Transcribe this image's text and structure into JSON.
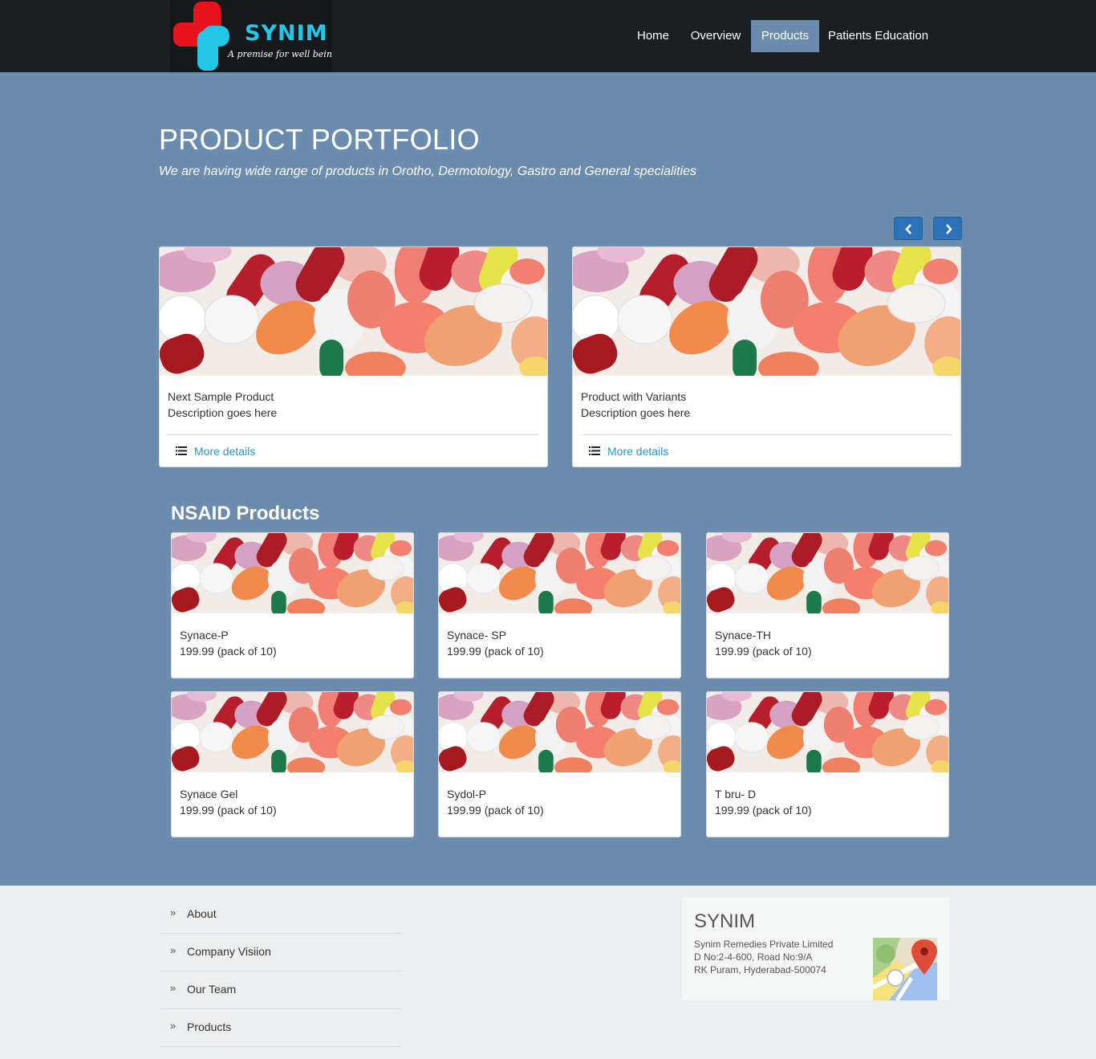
{
  "header": {
    "brand": "SYNIM",
    "tagline": "A premise for well being",
    "nav": [
      {
        "label": "Home",
        "active": false
      },
      {
        "label": "Overview",
        "active": false
      },
      {
        "label": "Products",
        "active": true
      },
      {
        "label": "Patients Education",
        "active": false
      }
    ]
  },
  "portfolio": {
    "title": "PRODUCT PORTFOLIO",
    "subtitle": "We are having wide range of products in Orotho, Dermotology, Gastro and General specialities",
    "prev_icon": "chevron-left-icon",
    "next_icon": "chevron-right-icon",
    "featured": [
      {
        "name": "Next Sample Product",
        "desc": "Description goes here",
        "more": "More details"
      },
      {
        "name": "Product with Variants",
        "desc": "Description goes here",
        "more": "More details"
      }
    ]
  },
  "nsaid": {
    "title": "NSAID Products",
    "items": [
      {
        "name": "Synace-P",
        "price": "199.99 (pack of 10)"
      },
      {
        "name": "Synace- SP",
        "price": "199.99 (pack of 10)"
      },
      {
        "name": "Synace-TH",
        "price": "199.99 (pack of 10)"
      },
      {
        "name": "Synace Gel",
        "price": "199.99 (pack of 10)"
      },
      {
        "name": "Sydol-P",
        "price": "199.99 (pack of 10)"
      },
      {
        "name": "T bru- D",
        "price": "199.99 (pack of 10)"
      }
    ]
  },
  "footer": {
    "links": [
      {
        "chevron": "»",
        "label": "About"
      },
      {
        "chevron": "»",
        "label": "Company Visiion"
      },
      {
        "chevron": "»",
        "label": "Our Team"
      },
      {
        "chevron": "»",
        "label": "Products"
      }
    ],
    "contact": {
      "title": "SYNIM",
      "line1": "Synim Remedies Private Limited",
      "line2": "D No:2-4-600, Road No:9/A",
      "line3": "RK Puram, Hyderabad-500074",
      "map_icon": "google-maps-icon"
    }
  },
  "colors": {
    "header_bg": "#1b1f22",
    "page_bg": "#6c8cad",
    "brand_cyan": "#23c6e6",
    "brand_red": "#e8141c",
    "arrow_button": "#2a73b8",
    "link": "#2a95c8",
    "footer_bg": "#eceeef"
  }
}
